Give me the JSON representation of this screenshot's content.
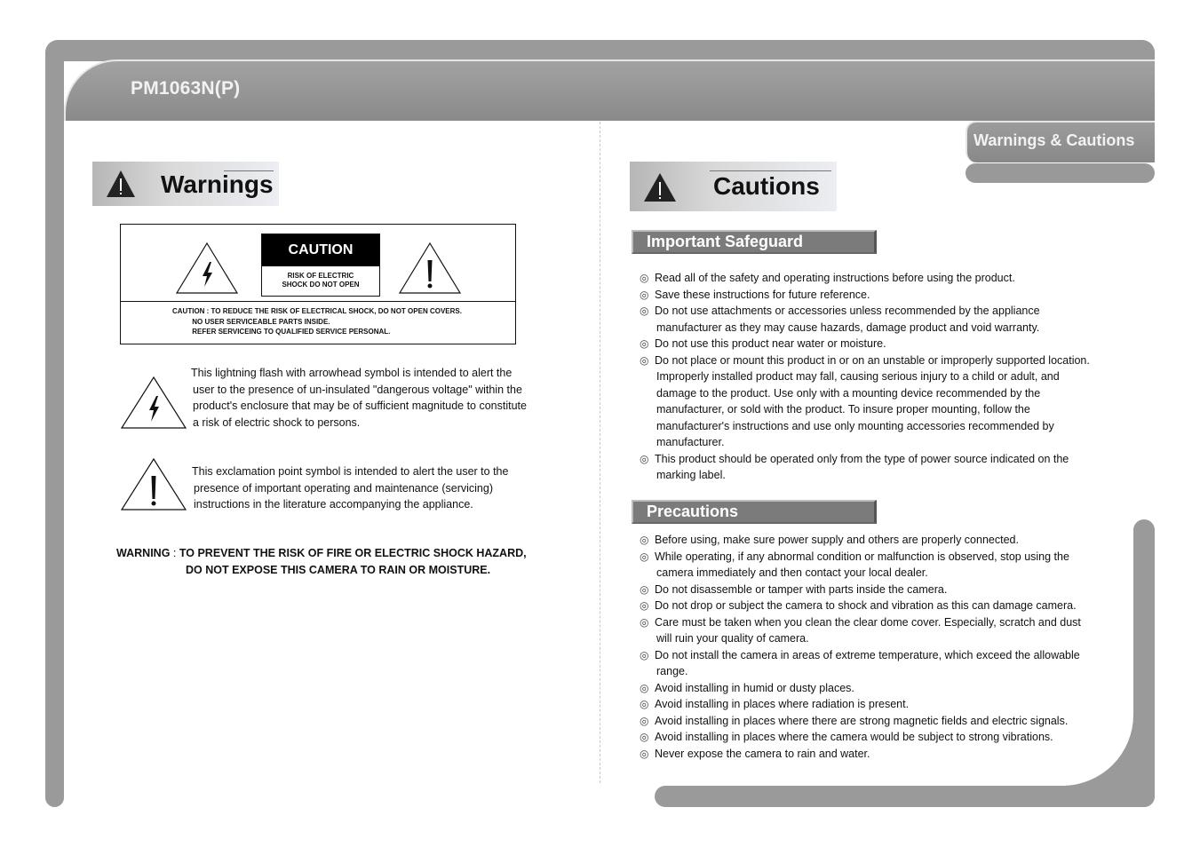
{
  "header": {
    "model": "PM1063N(P)",
    "section_tab": "Warnings & Cautions"
  },
  "warnings": {
    "title": "Warnings",
    "caution_label": {
      "title": "CAUTION",
      "subtitle_line1": "RISK OF ELECTRIC",
      "subtitle_line2": "SHOCK DO NOT OPEN",
      "notice": "CAUTION : TO REDUCE THE RISK OF ELECTRICAL SHOCK, DO NOT OPEN COVERS.\n          NO USER SERVICEABLE PARTS INSIDE.\n          REFER SERVICEING TO QUALIFIED SERVICE PERSONAL."
    },
    "symbols": [
      {
        "icon": "lightning-warning-icon",
        "lines": [
          "This lightning flash with arrowhead symbol is intended to alert the",
          "user to the presence of un-insulated \"dangerous voltage\" within the",
          "product's enclosure that may be of sufficient magnitude to constitute",
          "a risk of electric shock to persons."
        ]
      },
      {
        "icon": "exclamation-warning-icon",
        "lines": [
          "This exclamation point symbol is intended to alert the user to the",
          "presence of important operating and maintenance (servicing)",
          "instructions in the literature accompanying the appliance."
        ]
      }
    ],
    "final_warning": {
      "label": "WARNING",
      "separator": " : ",
      "line1": "TO PREVENT THE RISK OF FIRE OR ELECTRIC SHOCK HAZARD,",
      "line2": "DO NOT EXPOSE THIS CAMERA TO RAIN OR MOISTURE."
    }
  },
  "cautions": {
    "title": "Cautions",
    "bullet": "◎",
    "important_safeguard": {
      "title": "Important Safeguard",
      "items": [
        {
          "lines": [
            "Read all of the safety and operating instructions before using the product."
          ]
        },
        {
          "lines": [
            "Save these instructions for future reference."
          ]
        },
        {
          "lines": [
            "Do not use attachments or accessories unless recommended by the appliance",
            "manufacturer as they may cause hazards, damage product and void warranty."
          ]
        },
        {
          "lines": [
            "Do not use this product near water or moisture."
          ]
        },
        {
          "lines": [
            "Do not place or mount this product in or on an unstable or improperly supported location.",
            "Improperly installed product may fall, causing serious injury to a child or adult, and",
            "damage to the product. Use only with a mounting device recommended by the",
            "manufacturer, or sold with the product. To insure proper mounting, follow the",
            "manufacturer's instructions and use only mounting accessories recommended by",
            "manufacturer."
          ]
        },
        {
          "lines": [
            "This product should be operated only from the type of power source indicated on the",
            "marking label."
          ]
        }
      ]
    },
    "precautions": {
      "title": "Precautions",
      "items": [
        {
          "lines": [
            "Before using, make sure power supply and others are properly connected."
          ]
        },
        {
          "lines": [
            "While operating, if any abnormal condition or malfunction is observed, stop using the",
            "camera immediately and then contact your local dealer."
          ]
        },
        {
          "lines": [
            "Do not disassemble or tamper with parts inside the camera."
          ]
        },
        {
          "lines": [
            "Do not drop or subject the camera to shock and vibration as this can damage camera."
          ]
        },
        {
          "lines": [
            "Care must be taken when you clean the clear dome cover. Especially, scratch and dust",
            "will ruin your quality of camera."
          ]
        },
        {
          "lines": [
            "Do not install the camera in areas of extreme temperature, which exceed the allowable",
            "range."
          ]
        },
        {
          "lines": [
            "Avoid installing in humid or dusty places."
          ]
        },
        {
          "lines": [
            "Avoid installing in places where radiation is present."
          ]
        },
        {
          "lines": [
            "Avoid installing in places where there are strong magnetic fields and electric signals."
          ]
        },
        {
          "lines": [
            "Avoid installing in places where the camera would be subject to strong vibrations."
          ]
        },
        {
          "lines": [
            "Never expose the camera to rain and water."
          ]
        }
      ]
    }
  }
}
